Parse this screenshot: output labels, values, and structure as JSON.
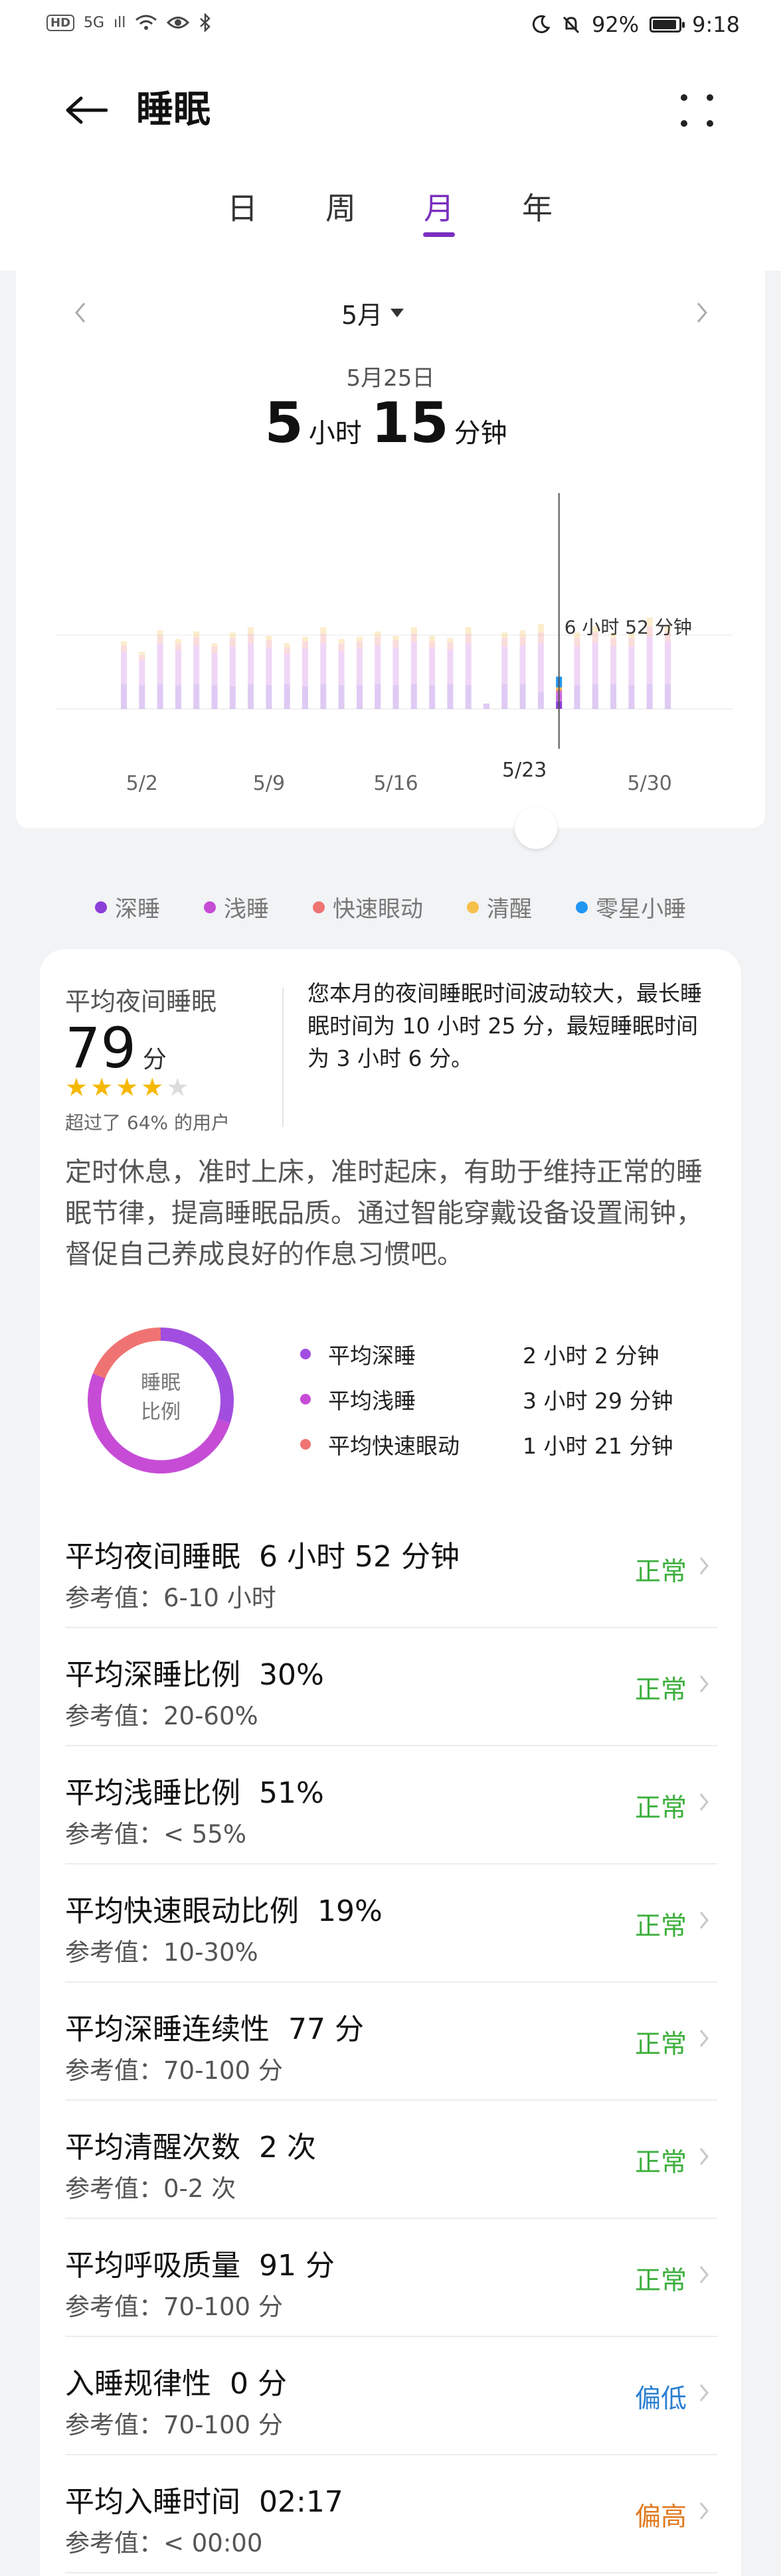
{
  "status_bar": {
    "left_badges": [
      "HD",
      "5G",
      "ıll"
    ],
    "battery_percent": "92%",
    "battery_level": 0.92,
    "time": "9:18"
  },
  "header": {
    "title": "睡眠",
    "tabs": [
      {
        "label": "日"
      },
      {
        "label": "周"
      },
      {
        "label": "月",
        "active": true
      },
      {
        "label": "年"
      }
    ]
  },
  "chart_panel": {
    "month_label": "5月",
    "selected_date": "5月25日",
    "selected_hours": "5",
    "hours_unit": "小时",
    "selected_minutes": "15",
    "minutes_unit": "分钟"
  },
  "chart_data": {
    "type": "bar",
    "stacked": true,
    "categories": [
      "5/1",
      "5/2",
      "5/3",
      "5/4",
      "5/5",
      "5/6",
      "5/7",
      "5/8",
      "5/9",
      "5/10",
      "5/11",
      "5/12",
      "5/13",
      "5/14",
      "5/15",
      "5/16",
      "5/17",
      "5/18",
      "5/19",
      "5/20",
      "5/21",
      "5/22",
      "5/23",
      "5/24",
      "5/25",
      "5/26",
      "5/27",
      "5/28",
      "5/29",
      "5/30",
      "5/31"
    ],
    "x_tick_labels": [
      "5/2",
      "5/9",
      "5/16",
      "5/23",
      "5/30"
    ],
    "units": "hours",
    "series": [
      {
        "name": "深睡",
        "color": "#8b3fd9",
        "values": [
          2.3,
          2.2,
          2.3,
          2.2,
          2.3,
          2.2,
          2.1,
          2.3,
          2.2,
          2.3,
          2.1,
          2.3,
          2.2,
          2.2,
          2.3,
          2.2,
          2.3,
          2.2,
          2.3,
          2.2,
          0.5,
          2.3,
          2.3,
          1.6,
          0.7,
          2.2,
          2.3,
          2.3,
          2.2,
          2.3,
          2.3
        ]
      },
      {
        "name": "浅睡",
        "color": "#c86be0",
        "values": [
          3.0,
          2.3,
          3.7,
          3.3,
          3.6,
          3.0,
          3.7,
          3.8,
          3.5,
          2.8,
          3.5,
          3.8,
          3.2,
          3.4,
          3.6,
          3.5,
          3.9,
          3.4,
          3.2,
          3.9,
          0.0,
          3.5,
          3.6,
          4.5,
          0.9,
          3.6,
          3.9,
          3.5,
          3.6,
          4.4,
          4.0
        ]
      },
      {
        "name": "快速眼动",
        "color": "#f08080",
        "values": [
          0.6,
          0.5,
          0.8,
          0.6,
          0.8,
          0.6,
          0.8,
          0.9,
          0.7,
          0.6,
          0.7,
          0.9,
          0.7,
          0.7,
          0.8,
          0.7,
          0.8,
          0.7,
          0.7,
          0.9,
          0.0,
          0.8,
          0.8,
          1.0,
          0.2,
          0.8,
          0.9,
          0.8,
          0.8,
          1.0,
          0.9
        ]
      },
      {
        "name": "清醒",
        "color": "#f6c04a",
        "values": [
          0.4,
          0.3,
          0.5,
          0.4,
          0.5,
          0.3,
          0.5,
          0.6,
          0.4,
          0.4,
          0.4,
          0.6,
          0.4,
          0.4,
          0.5,
          0.4,
          0.6,
          0.5,
          0.4,
          0.6,
          0.0,
          0.5,
          0.6,
          0.8,
          0.2,
          0.5,
          0.6,
          0.5,
          0.5,
          0.8,
          0.6
        ]
      },
      {
        "name": "零星小睡",
        "color": "#2196f3",
        "values": [
          0.0,
          0.0,
          0.0,
          0.0,
          0.0,
          0.0,
          0.0,
          0.0,
          0.0,
          0.0,
          0.0,
          0.0,
          0.0,
          0.0,
          0.0,
          0.0,
          0.0,
          0.0,
          0.0,
          0.0,
          0.0,
          0.0,
          0.0,
          0.0,
          1.0,
          0.0,
          0.0,
          0.0,
          0.0,
          0.0,
          0.0
        ]
      }
    ],
    "selected_index": 24,
    "ylim": [
      0,
      14
    ],
    "avg_line_hours": 6.87,
    "avg_label": "6 小时 52 分钟",
    "selected_marker_label": "5/23"
  },
  "legend": [
    {
      "label": "深睡",
      "color": "#8b3fd9"
    },
    {
      "label": "浅睡",
      "color": "#c64cd6"
    },
    {
      "label": "快速眼动",
      "color": "#f07373"
    },
    {
      "label": "清醒",
      "color": "#f6c04a"
    },
    {
      "label": "零星小睡",
      "color": "#2196f3"
    }
  ],
  "summary": {
    "score_label": "平均夜间睡眠",
    "score": "79",
    "score_unit": "分",
    "stars": 4,
    "stars_max": 5,
    "percentile": "超过了 64% 的用户",
    "description": "您本月的夜间睡眠时间波动较大，最长睡眠时间为 10 小时 25 分，最短睡眠时间为 3 小时 6 分。",
    "advice": "定时休息，准时上床，准时起床，有助于维持正常的睡眠节律，提高睡眠品质。通过智能穿戴设备设置闹钟，督促自己养成良好的作息习惯吧。"
  },
  "ratio": {
    "center_label_1": "睡眠",
    "center_label_2": "比例",
    "items": [
      {
        "label": "平均深睡",
        "value": "2 小时 2 分钟",
        "color": "#a14ee0",
        "fraction": 0.3
      },
      {
        "label": "平均浅睡",
        "value": "3 小时 29 分钟",
        "color": "#c64cd6",
        "fraction": 0.51
      },
      {
        "label": "平均快速眼动",
        "value": "1 小时 21 分钟",
        "color": "#f07373",
        "fraction": 0.19
      }
    ]
  },
  "metrics": [
    {
      "title": "平均夜间睡眠",
      "value": "6 小时 52 分钟",
      "ref": "参考值：6-10 小时",
      "status": "正常",
      "kind": "normal"
    },
    {
      "title": "平均深睡比例",
      "value": "30%",
      "ref": "参考值：20-60%",
      "status": "正常",
      "kind": "normal"
    },
    {
      "title": "平均浅睡比例",
      "value": "51%",
      "ref": "参考值：< 55%",
      "status": "正常",
      "kind": "normal"
    },
    {
      "title": "平均快速眼动比例",
      "value": "19%",
      "ref": "参考值：10-30%",
      "status": "正常",
      "kind": "normal"
    },
    {
      "title": "平均深睡连续性",
      "value": "77 分",
      "ref": "参考值：70-100 分",
      "status": "正常",
      "kind": "normal"
    },
    {
      "title": "平均清醒次数",
      "value": "2 次",
      "ref": "参考值：0-2 次",
      "status": "正常",
      "kind": "normal"
    },
    {
      "title": "平均呼吸质量",
      "value": "91 分",
      "ref": "参考值：70-100 分",
      "status": "正常",
      "kind": "normal"
    },
    {
      "title": "入睡规律性",
      "value": "0 分",
      "ref": "参考值：70-100 分",
      "status": "偏低",
      "kind": "low"
    },
    {
      "title": "平均入睡时间",
      "value": "02:17",
      "ref": "参考值：< 00:00",
      "status": "偏高",
      "kind": "high"
    }
  ]
}
